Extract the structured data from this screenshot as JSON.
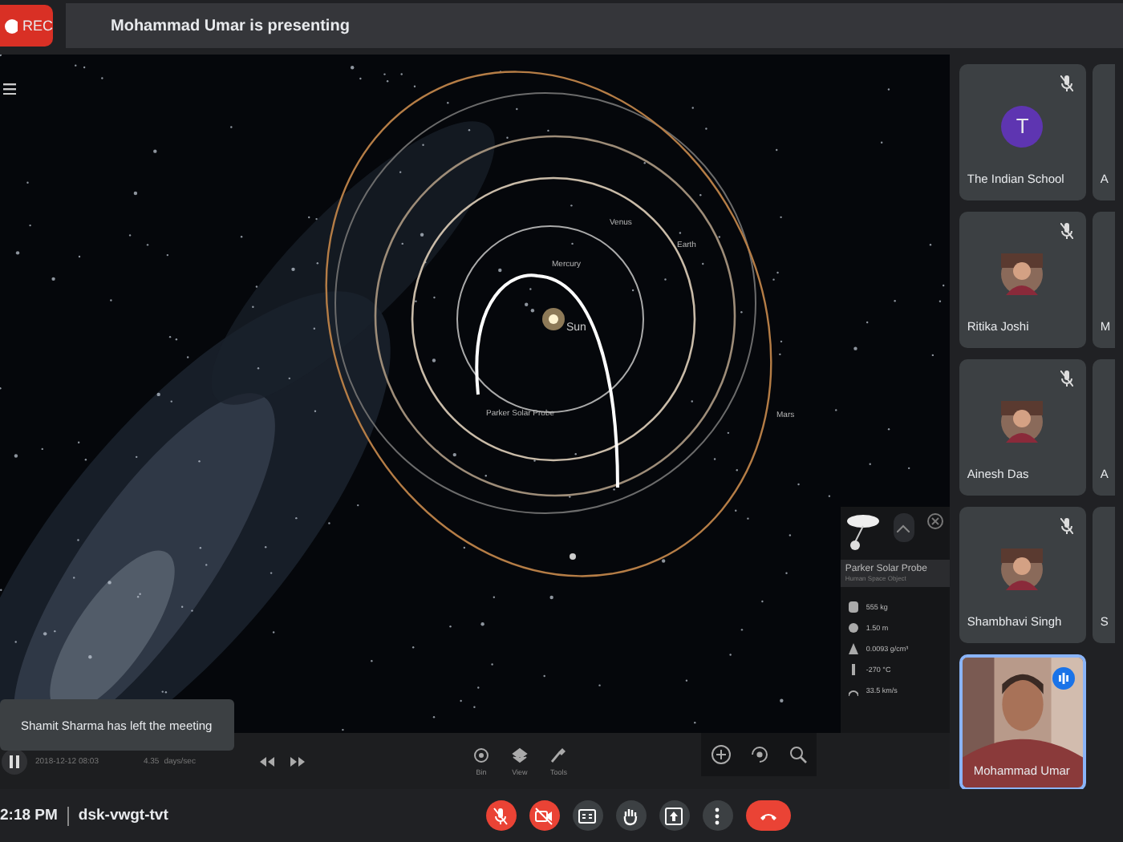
{
  "recording": {
    "label": "REC",
    "on": true
  },
  "banner": "Mohammad Umar is presenting",
  "orbit_labels": [
    {
      "kind": "venus",
      "text": "Venus"
    },
    {
      "kind": "mercury",
      "text": "Mercury"
    },
    {
      "kind": "earth",
      "text": "Earth"
    },
    {
      "kind": "sun",
      "text": "Sun"
    },
    {
      "kind": "probe",
      "text": "Parker Solar Probe"
    },
    {
      "kind": "mars",
      "text": "Mars"
    }
  ],
  "info_panel": {
    "title": "Parker Solar Probe",
    "subtitle": "Human Space Object",
    "stats": [
      {
        "kind": "mass",
        "text": "555 kg"
      },
      {
        "kind": "size",
        "text": "1.50 m"
      },
      {
        "kind": "density",
        "text": "0.0093 g/cm³"
      },
      {
        "kind": "temperature",
        "text": "-270 °C"
      },
      {
        "kind": "speed",
        "text": "33.5 km/s"
      }
    ]
  },
  "playback": {
    "playing": true,
    "date": "2018-12-12 08:03",
    "rate": "4.35",
    "rate_unit": "days/sec"
  },
  "tools": [
    {
      "kind": "target",
      "label": "Bin"
    },
    {
      "kind": "layers",
      "label": "View"
    },
    {
      "kind": "wrench",
      "label": "Tools"
    }
  ],
  "toast": "Shamit Sharma has left the meeting",
  "participants": [
    {
      "name": "The Indian School",
      "muted": true,
      "speaking": false,
      "avatar": {
        "kind": "letter",
        "letter": "T"
      }
    },
    {
      "name": "Ritika Joshi",
      "muted": true,
      "speaking": false
    },
    {
      "name": "Ainesh Das",
      "muted": true,
      "speaking": false
    },
    {
      "name": "Shambhavi Singh",
      "muted": true,
      "speaking": false
    },
    {
      "name": "Mohammad Umar",
      "muted": false,
      "speaking": true,
      "avatar": {
        "kind": "video"
      }
    }
  ],
  "participants_cut": [
    "A",
    "M",
    "A",
    "S"
  ],
  "footer": {
    "time": "2:18 PM",
    "meeting_code": "dsk-vwgt-tvt"
  },
  "controls": [
    {
      "kind": "mic",
      "off": true
    },
    {
      "kind": "camera",
      "off": true
    },
    {
      "kind": "captions",
      "off": false
    },
    {
      "kind": "hand",
      "off": false
    },
    {
      "kind": "present",
      "off": false
    },
    {
      "kind": "more",
      "off": false
    },
    {
      "kind": "end"
    }
  ]
}
